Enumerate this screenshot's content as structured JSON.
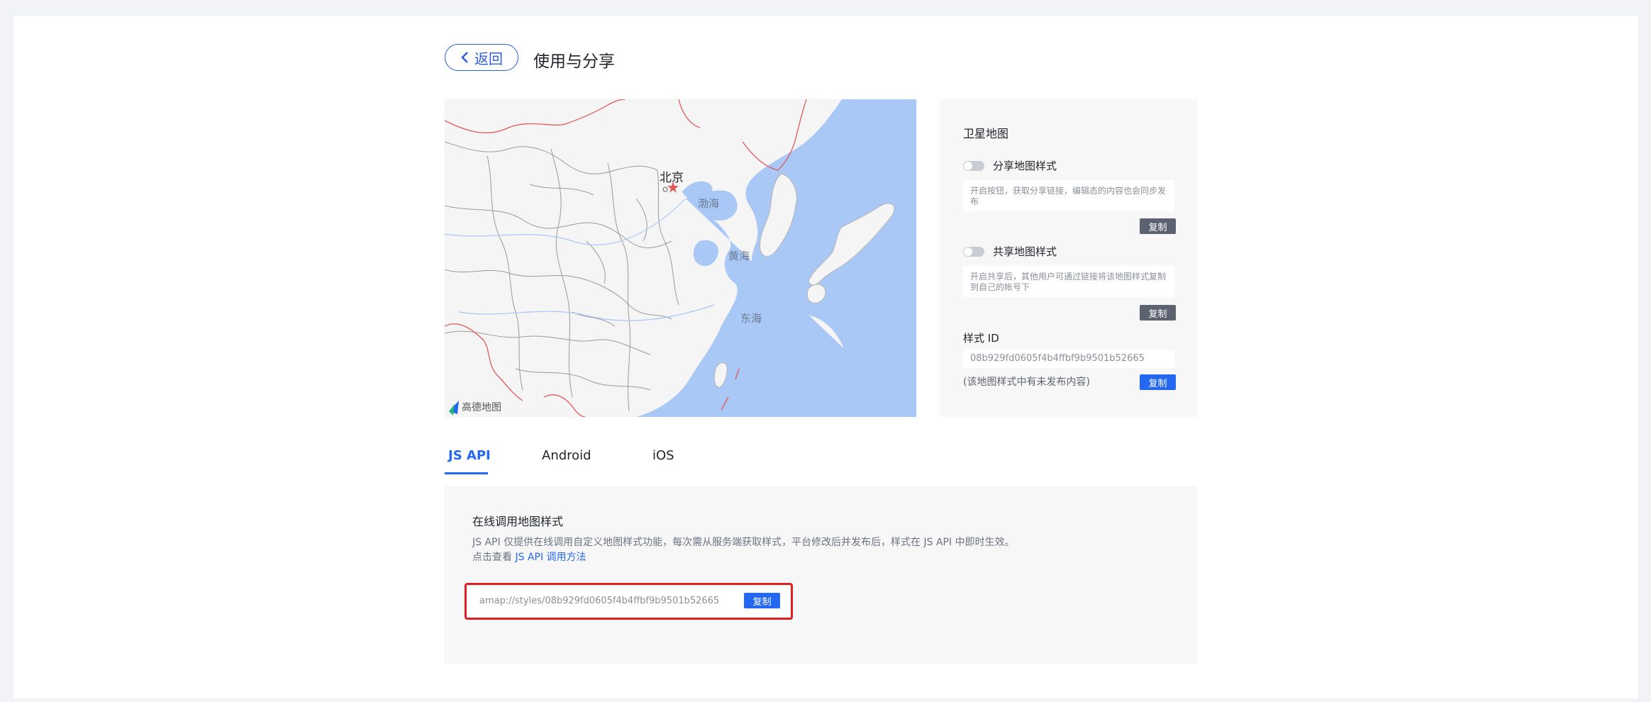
{
  "header": {
    "back_label": "返回",
    "title": "使用与分享"
  },
  "map": {
    "city": "北京",
    "seas": [
      "渤海",
      "黄海",
      "东海"
    ],
    "logo_text": "高德地图",
    "land_color": "#f5f5f5",
    "water_color": "#a9c8f5",
    "border_color": "#e15a5a"
  },
  "panel": {
    "title": "卫星地图",
    "share": {
      "label": "分享地图样式",
      "description": "开启按钮，获取分享链接，编辑态的内容也会同步发布",
      "copy_label": "复制"
    },
    "public": {
      "label": "共享地图样式",
      "description": "开启共享后，其他用户可通过链接将该地图样式复制到自己的帐号下",
      "copy_label": "复制"
    },
    "style_id": {
      "label": "样式 ID",
      "value": "08b929fd0605f4b4ffbf9b9501b52665",
      "note": "(该地图样式中有未发布内容)",
      "copy_label": "复制"
    }
  },
  "tabs": [
    {
      "label": "JS API",
      "active": true
    },
    {
      "label": "Android",
      "active": false
    },
    {
      "label": "iOS",
      "active": false
    }
  ],
  "section": {
    "title": "在线调用地图样式",
    "desc_line1": "JS API 仅提供在线调用自定义地图样式功能，每次需从服务端获取样式，平台修改后并发布后，样式在 JS API 中即时生效。",
    "desc_line2_prefix": "点击查看 ",
    "desc_link": "JS API 调用方法",
    "url": "amap://styles/08b929fd0605f4b4ffbf9b9501b52665",
    "copy_label": "复制"
  },
  "colors": {
    "accent": "#2468f2",
    "highlight_border": "#e02020"
  }
}
